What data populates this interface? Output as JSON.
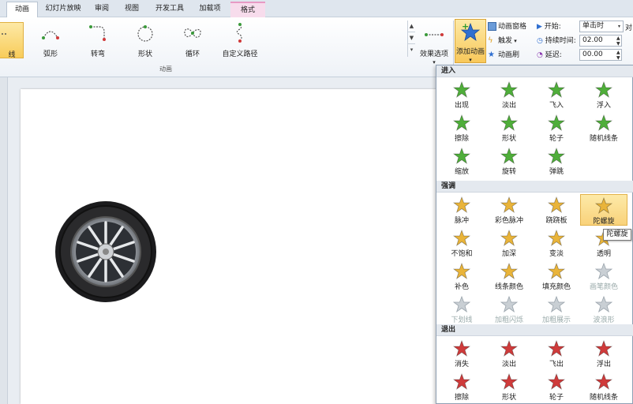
{
  "tabs": [
    {
      "label": "动画",
      "active": true
    },
    {
      "label": "幻灯片放映"
    },
    {
      "label": "审阅"
    },
    {
      "label": "视图"
    },
    {
      "label": "开发工具"
    },
    {
      "label": "加载项"
    },
    {
      "label": "格式",
      "contextual": true
    }
  ],
  "ribbon": {
    "motion_paths": [
      {
        "label": "线",
        "selected": true,
        "icon": "line-path-icon"
      },
      {
        "label": "弧形",
        "icon": "arc-path-icon"
      },
      {
        "label": "转弯",
        "icon": "turn-path-icon"
      },
      {
        "label": "形状",
        "icon": "shape-path-icon"
      },
      {
        "label": "循环",
        "icon": "loop-path-icon"
      },
      {
        "label": "自定义路径",
        "icon": "custom-path-icon"
      }
    ],
    "group_label": "动画",
    "effect_options": "效果选项",
    "add_animation": "添加动画",
    "animation_pane": "动画窗格",
    "trigger": "触发",
    "animation_painter": "动画刷",
    "start_label": "开始:",
    "start_value": "单击时",
    "duration_label": "持续时间:",
    "duration_value": "02.00",
    "delay_label": "延迟:",
    "delay_value": "00.00",
    "reorder_label": "对"
  },
  "dropdown": {
    "sections": [
      {
        "title": "进入",
        "color": "#4fae3a",
        "items": [
          "出现",
          "淡出",
          "飞入",
          "浮入",
          "擦除",
          "形状",
          "轮子",
          "随机线条",
          "缩放",
          "旋转",
          "弹跳"
        ]
      },
      {
        "title": "强调",
        "color": "#e9b43a",
        "items": [
          "脉冲",
          "彩色脉冲",
          "跷跷板",
          "陀螺旋",
          "不饱和",
          "加深",
          "变淡",
          "透明",
          "补色",
          "线条颜色",
          "填充颜色",
          "画笔颜色",
          "下划线",
          "加粗闪烁",
          "加粗展示",
          "波浪形"
        ]
      },
      {
        "title": "退出",
        "color": "#cf3b3b",
        "items": [
          "消失",
          "淡出",
          "飞出",
          "浮出",
          "擦除",
          "形状",
          "轮子",
          "随机线条"
        ]
      }
    ],
    "selected_item": "陀螺旋",
    "tooltip": "陀螺旋"
  },
  "colors": {
    "accent": "#f8cc5a",
    "enter": "#4fae3a",
    "emphasis": "#e9b43a",
    "exit": "#cf3b3b"
  }
}
